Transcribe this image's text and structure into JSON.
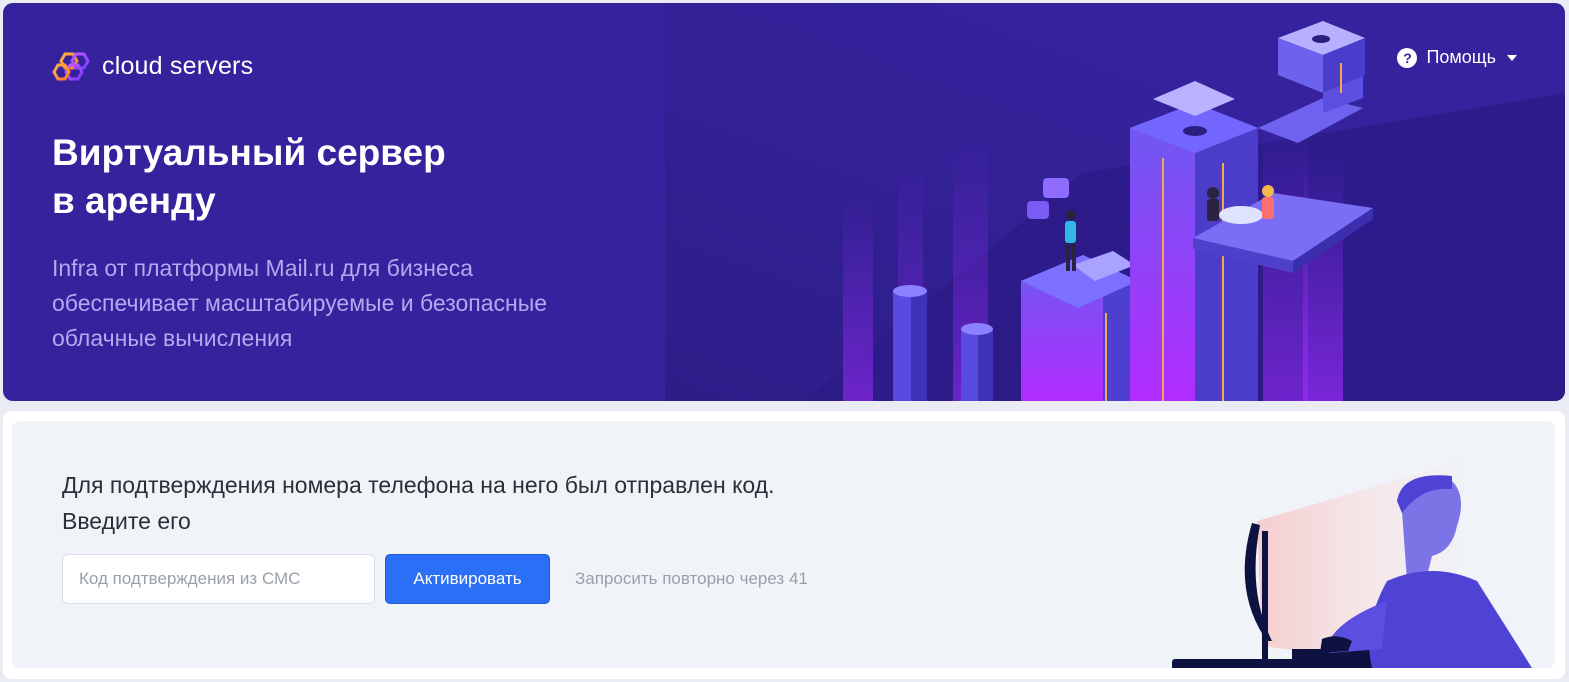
{
  "header": {
    "logo_text": "cloud servers",
    "help_label": "Помощь",
    "help_icon_glyph": "?",
    "title_line1": "Виртуальный сервер",
    "title_line2": "в аренду",
    "description_line1": "Infra от платформы Mail.ru для бизнеса",
    "description_line2": "обеспечивает масштабируемые и безопасные",
    "description_line3": "облачные вычисления",
    "icons": [
      "hexagon-logo-icon",
      "question-circle-icon",
      "caret-down-icon"
    ]
  },
  "verification": {
    "message_line1": "Для подтверждения номера телефона на него был отправлен код.",
    "message_line2": "Введите его",
    "code_input_value": "",
    "code_input_placeholder": "Код подтверждения из СМС",
    "activate_label": "Активировать",
    "resend_text": "Запросить повторно через 41"
  },
  "colors": {
    "hero_bg": "#35229c",
    "accent_button": "#2a6ff6",
    "panel_bg": "#f0f3f8",
    "description_text": "#b3a9f0"
  }
}
